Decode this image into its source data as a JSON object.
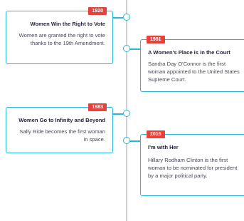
{
  "colors": {
    "accent": "#29b6d8",
    "badge": "#e8413c",
    "axis": "#cfcfd6"
  },
  "events": [
    {
      "year": "1920",
      "title": "Women Win the Right to Vote",
      "desc": "Women are granted the right to vote thanks to the 19th Amendment."
    },
    {
      "year": "1981",
      "title": "A Women's Place is in the Court",
      "desc": "Sandra Day O'Connor is the first woman appointed to the United States Supreme Court."
    },
    {
      "year": "1983",
      "title": "Women Go to Infinity and Beyond",
      "desc": "Sally Ride becomes the first woman in space."
    },
    {
      "year": "2016",
      "title": "I'm with Her",
      "desc": "Hillary Rodham Clinton is the first woman to be nominated for president by a major political party."
    }
  ]
}
